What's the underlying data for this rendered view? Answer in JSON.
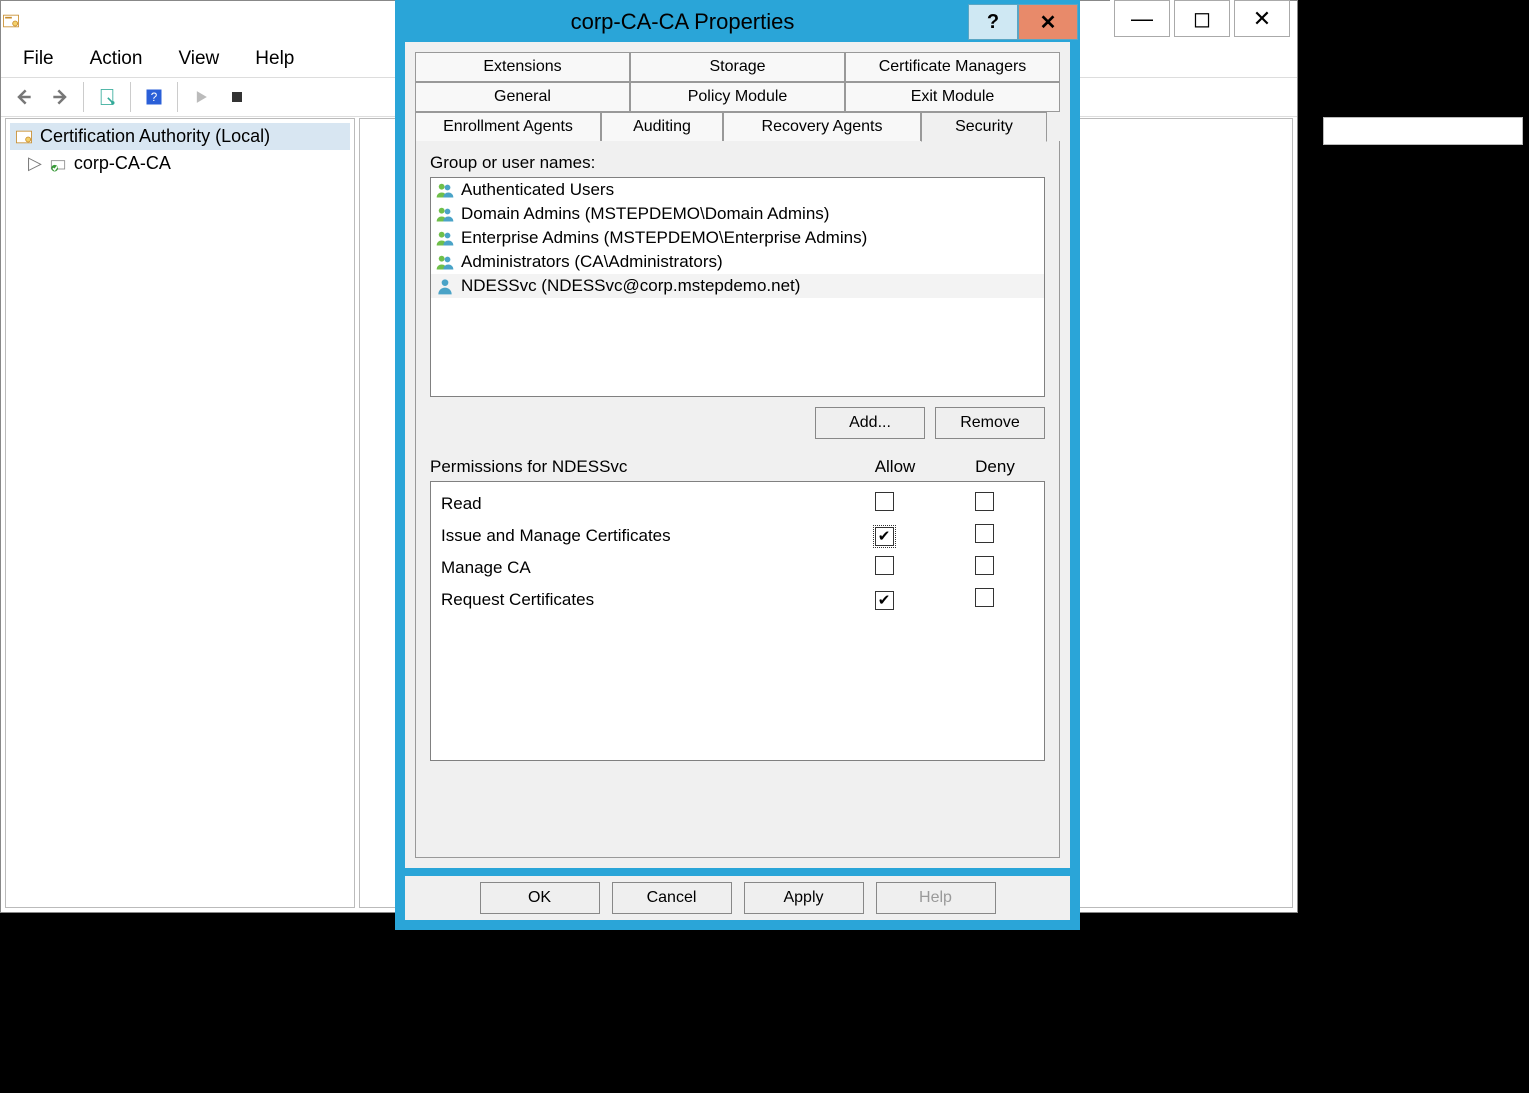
{
  "main": {
    "menus": [
      "File",
      "Action",
      "View",
      "Help"
    ],
    "tree": {
      "root": "Certification Authority (Local)",
      "child": "corp-CA-CA"
    }
  },
  "bg_controls": {
    "min": "—",
    "max": "◻",
    "close": "✕"
  },
  "dialog": {
    "title": "corp-CA-CA Properties",
    "help_symbol": "?",
    "close_symbol": "✕",
    "tabs_row1": [
      "Extensions",
      "Storage",
      "Certificate Managers"
    ],
    "tabs_row2": [
      "General",
      "Policy Module",
      "Exit Module"
    ],
    "tabs_row3": [
      "Enrollment Agents",
      "Auditing",
      "Recovery Agents",
      "Security"
    ],
    "active_tab": "Security",
    "group_label": "Group or user names:",
    "principals": [
      {
        "name": "Authenticated Users",
        "type": "group"
      },
      {
        "name": "Domain Admins (MSTEPDEMO\\Domain Admins)",
        "type": "group"
      },
      {
        "name": "Enterprise Admins (MSTEPDEMO\\Enterprise Admins)",
        "type": "group"
      },
      {
        "name": "Administrators (CA\\Administrators)",
        "type": "group"
      },
      {
        "name": "NDESSvc (NDESSvc@corp.mstepdemo.net)",
        "type": "user",
        "selected": true
      }
    ],
    "add_label": "Add...",
    "remove_label": "Remove",
    "perm_for_label": "Permissions for NDESSvc",
    "allow_label": "Allow",
    "deny_label": "Deny",
    "permissions": [
      {
        "name": "Read",
        "allow": false,
        "deny": false
      },
      {
        "name": "Issue and Manage Certificates",
        "allow": true,
        "deny": false,
        "focused": true
      },
      {
        "name": "Manage CA",
        "allow": false,
        "deny": false
      },
      {
        "name": "Request Certificates",
        "allow": true,
        "deny": false
      }
    ],
    "buttons": {
      "ok": "OK",
      "cancel": "Cancel",
      "apply": "Apply",
      "help": "Help"
    }
  }
}
